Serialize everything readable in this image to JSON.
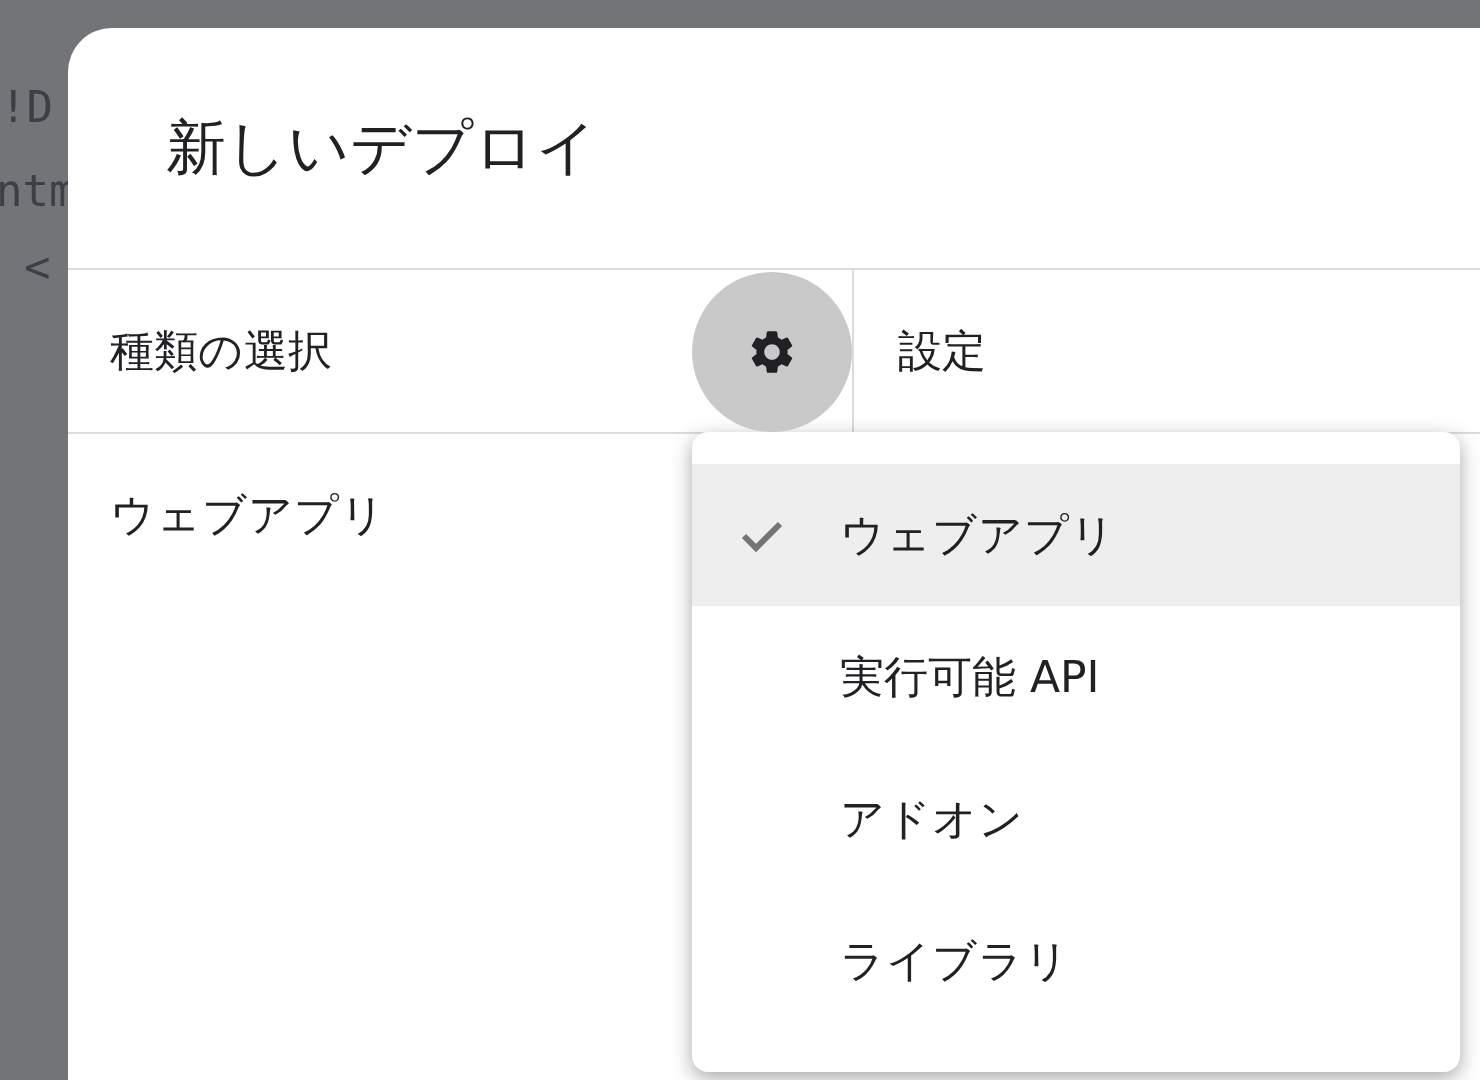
{
  "background_code": [
    "!D",
    "ntm",
    "<"
  ],
  "dialog": {
    "title": "新しいデプロイ",
    "type_header": "種類の選択",
    "settings_header": "設定",
    "chosen_type": "ウェブアプリ"
  },
  "type_menu": [
    {
      "label": "ウェブアプリ",
      "selected": true
    },
    {
      "label": "実行可能 API",
      "selected": false
    },
    {
      "label": "アドオン",
      "selected": false
    },
    {
      "label": "ライブラリ",
      "selected": false
    }
  ]
}
